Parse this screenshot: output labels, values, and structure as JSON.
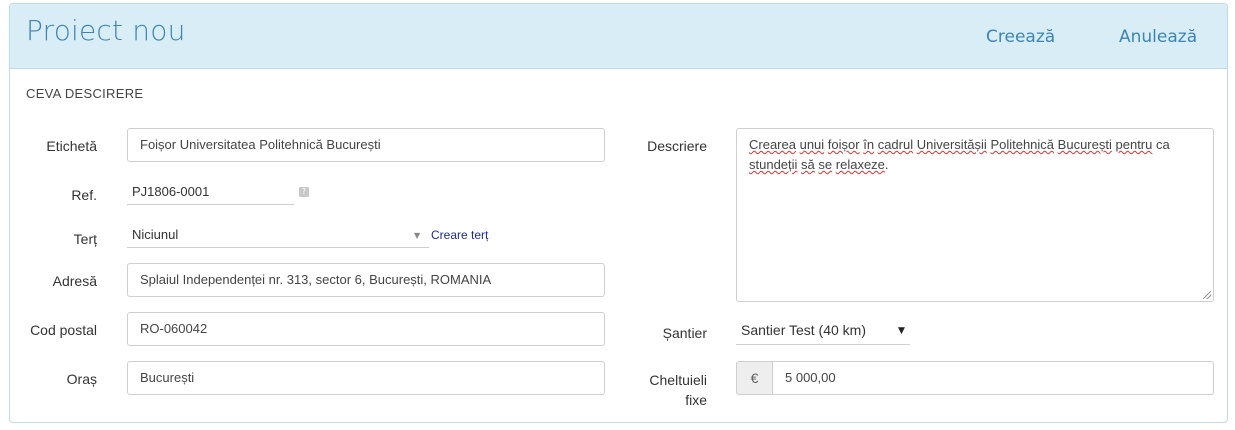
{
  "header": {
    "title": "Proiect nou",
    "create_label": "Creează",
    "cancel_label": "Anulează"
  },
  "section": {
    "title": "CEVA DESCIRERE"
  },
  "form": {
    "label": {
      "label": "Etichetă",
      "value": "Foișor Universitatea Politehnică București"
    },
    "ref": {
      "label": "Ref.",
      "value": "PJ1806-0001",
      "help": "?"
    },
    "third_party": {
      "label": "Terț",
      "value": "Niciunul",
      "create_link": "Creare terț"
    },
    "address": {
      "label": "Adresă",
      "value": "Splaiul Independenței nr. 313, sector 6, București, ROMANIA"
    },
    "postal_code": {
      "label": "Cod postal",
      "value": "RO-060042"
    },
    "city": {
      "label": "Oraș",
      "value": "București"
    },
    "description": {
      "label": "Descriere",
      "words": [
        "Crearea",
        " ",
        "unui",
        " ",
        "foișor",
        " ",
        "în",
        " ",
        "cadrul",
        " ",
        "Universitășii",
        " ",
        "Politehnică",
        " ",
        "București",
        " ",
        "pentru",
        " ",
        "ca",
        " ",
        "stundeții",
        " ",
        "să",
        " ",
        "se",
        " ",
        "relaxeze",
        "."
      ]
    },
    "site": {
      "label": "Șantier",
      "value": "Santier Test (40 km)"
    },
    "fixed_costs": {
      "label_line1": "Cheltuieli",
      "label_line2": "fixe",
      "currency": "€",
      "value": "5 000,00"
    }
  }
}
